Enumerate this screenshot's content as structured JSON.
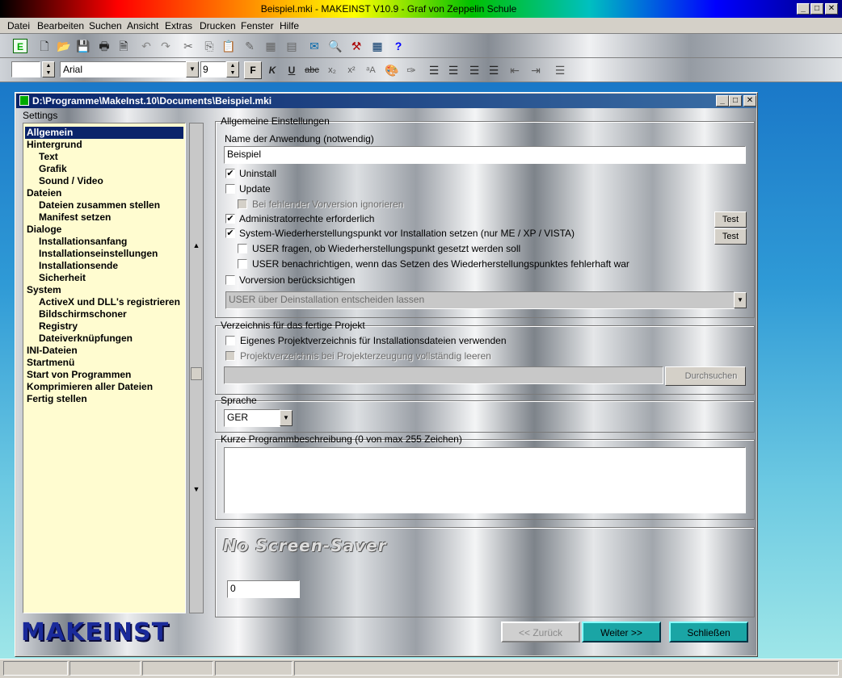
{
  "window": {
    "title": "Beispiel.mki - MAKEINST V10.9 - Graf von Zeppelin Schule",
    "min": "_",
    "max": "□",
    "close": "✕"
  },
  "menu": [
    "Datei",
    "Bearbeiten",
    "Suchen",
    "Ansicht",
    "Extras",
    "Drucken",
    "Fenster",
    "Hilfe"
  ],
  "format": {
    "font": "Arial",
    "size": "9",
    "bold": "F",
    "italic": "K",
    "underline": "U",
    "strike": "abc"
  },
  "child": {
    "title": "D:\\Programme\\MakeInst.10\\Documents\\Beispiel.mki"
  },
  "sidebar": {
    "label": "Settings",
    "items": [
      {
        "label": "Allgemein",
        "indent": 0
      },
      {
        "label": "Hintergrund",
        "indent": 0
      },
      {
        "label": "Text",
        "indent": 1
      },
      {
        "label": "Grafik",
        "indent": 1
      },
      {
        "label": "Sound / Video",
        "indent": 1
      },
      {
        "label": "Dateien",
        "indent": 0
      },
      {
        "label": "Dateien zusammen stellen",
        "indent": 1
      },
      {
        "label": "Manifest setzen",
        "indent": 1
      },
      {
        "label": "Dialoge",
        "indent": 0
      },
      {
        "label": "Installationsanfang",
        "indent": 1
      },
      {
        "label": "Installationseinstellungen",
        "indent": 1
      },
      {
        "label": "Installationsende",
        "indent": 1
      },
      {
        "label": "Sicherheit",
        "indent": 1
      },
      {
        "label": "System",
        "indent": 0
      },
      {
        "label": "ActiveX und DLL's registrieren",
        "indent": 1
      },
      {
        "label": "Bildschirmschoner",
        "indent": 1
      },
      {
        "label": "Registry",
        "indent": 1
      },
      {
        "label": "Dateiverknüpfungen",
        "indent": 1
      },
      {
        "label": "INI-Dateien",
        "indent": 0
      },
      {
        "label": "Startmenü",
        "indent": 0
      },
      {
        "label": "Start von Programmen",
        "indent": 0
      },
      {
        "label": "Komprimieren aller Dateien",
        "indent": 0
      },
      {
        "label": "Fertig stellen",
        "indent": 0
      }
    ]
  },
  "general": {
    "group_label": "Allgemeine Einstellungen",
    "app_name_label": "Name der Anwendung (notwendig)",
    "app_name_value": "Beispiel",
    "uninstall": "Uninstall",
    "update": "Update",
    "ignore_missing": "Bei fehlender Vorversion ignorieren",
    "admin_rights": "Administratorrechte erforderlich",
    "restore_point": "System-Wiederherstellungspunkt vor Installation setzen (nur ME / XP / VISTA)",
    "ask_user": "USER fragen, ob Wiederherstellungspunkt gesetzt werden soll",
    "notify_user": "USER benachrichtigen, wenn das Setzen des Wiederherstellungspunktes fehlerhaft war",
    "prev_version": "Vorversion berücksichtigen",
    "uninstall_select": "USER über Deinstallation entscheiden lassen",
    "test_label": "Test",
    "check": "✔"
  },
  "project_dir": {
    "group_label": "Verzeichnis für das fertige Projekt",
    "own_dir": "Eigenes Projektverzeichnis für Installationsdateien verwenden",
    "clear_dir": "Projektverzeichnis bei Projekterzeugung vollständig leeren",
    "browse": "Durchsuchen"
  },
  "language": {
    "group_label": "Sprache",
    "value": "GER"
  },
  "description": {
    "group_label": "Kurze Programmbeschreibung (0 von max 255 Zeichen)"
  },
  "screensaver": {
    "title": "No Screen-Saver",
    "value": "0"
  },
  "footer": {
    "logo": "MAKEINST",
    "back": "<< Zurück",
    "next": "Weiter >>",
    "close": "Schließen"
  }
}
